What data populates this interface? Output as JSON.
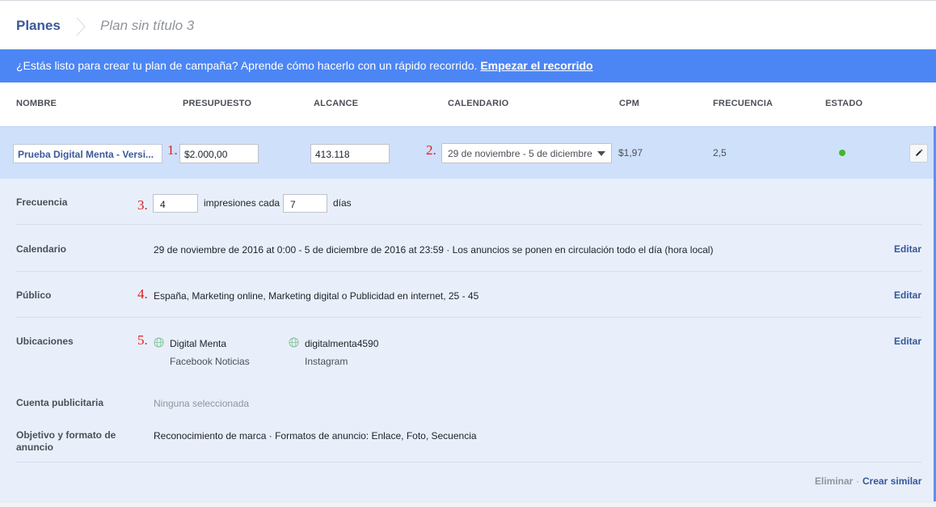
{
  "breadcrumb": {
    "root": "Planes",
    "current": "Plan sin título 3"
  },
  "banner": {
    "text": "¿Estás listo para crear tu plan de campaña? Aprende cómo hacerlo con un rápido recorrido. ",
    "link": "Empezar el recorrido"
  },
  "columns": {
    "name": "NOMBRE",
    "budget": "PRESUPUESTO",
    "reach": "ALCANCE",
    "schedule": "CALENDARIO",
    "cpm": "CPM",
    "frequency": "FRECUENCIA",
    "status": "ESTADO"
  },
  "plan": {
    "name": "Prueba Digital Menta - Versi...",
    "budget": "$2.000,00",
    "reach": "413.118",
    "schedule": "29 de noviembre - 5 de diciembre",
    "cpm": "$1,97",
    "frequency": "2,5",
    "status_color": "#42b72a"
  },
  "annotations": [
    "1.",
    "2.",
    "3.",
    "4.",
    "5."
  ],
  "details": {
    "frequency": {
      "label": "Frecuencia",
      "impressions": "4",
      "mid_text": "impresiones cada",
      "days": "7",
      "suffix": "días"
    },
    "schedule": {
      "label": "Calendario",
      "value": "29 de noviembre de 2016 at 0:00 - 5 de diciembre de 2016 at 23:59 · Los anuncios se ponen en circulación todo el día (hora local)",
      "edit": "Editar"
    },
    "audience": {
      "label": "Público",
      "value": "España, Marketing online, Marketing digital o Publicidad en internet, 25 - 45",
      "edit": "Editar"
    },
    "placements": {
      "label": "Ubicaciones",
      "edit": "Editar",
      "items": [
        {
          "account": "Digital Menta",
          "platform": "Facebook Noticias"
        },
        {
          "account": "digitalmenta4590",
          "platform": "Instagram"
        }
      ]
    },
    "ad_account": {
      "label": "Cuenta publicitaria",
      "value": "Ninguna seleccionada"
    },
    "objective": {
      "label": "Objetivo y formato de anuncio",
      "value": "Reconocimiento de marca · Formatos de anuncio: Enlace, Foto, Secuencia"
    }
  },
  "actions": {
    "delete": "Eliminar",
    "separator": "·",
    "create_similar": "Crear similar"
  },
  "colors": {
    "brand": "#3b5998",
    "banner": "#4c86f4",
    "row_selected": "#cfe0fb",
    "details_bg": "#e9effa",
    "annotation": "#e01b1b"
  }
}
